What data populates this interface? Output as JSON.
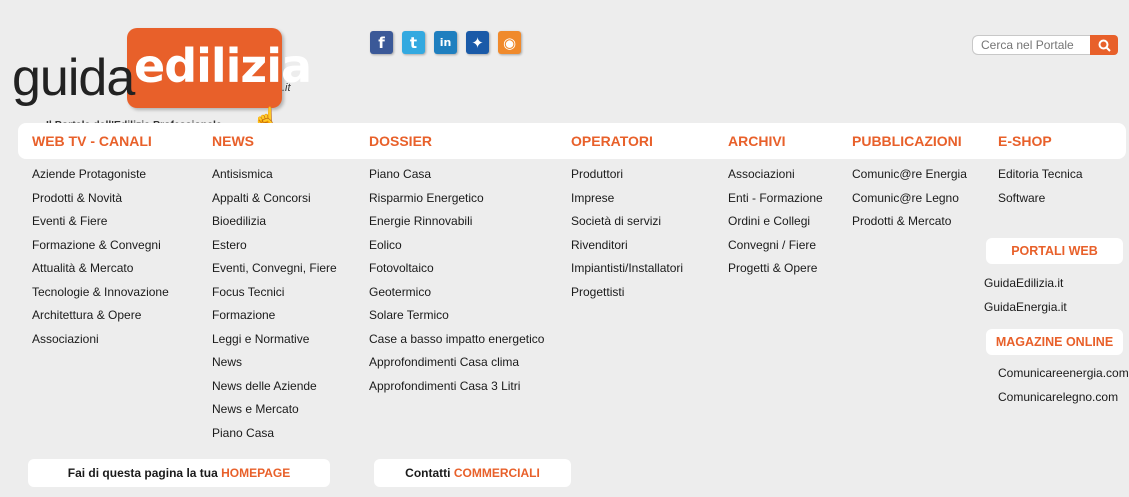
{
  "logo": {
    "guida": "guida",
    "edilizia": "edilizia",
    "it": ".it",
    "tagline": "Il Portale dell'Edilizia Professionale"
  },
  "social": [
    {
      "icon": "facebook-icon",
      "glyph": "f",
      "color": "#3b5998"
    },
    {
      "icon": "twitter-icon",
      "glyph": "t",
      "color": "#33a9e0"
    },
    {
      "icon": "linkedin-icon",
      "glyph": "in",
      "color": "#1f7fbf"
    },
    {
      "icon": "myspace-icon",
      "glyph": "✦",
      "color": "#1a5aa8"
    },
    {
      "icon": "rss-icon",
      "glyph": "◉",
      "color": "#f08a2c"
    }
  ],
  "search": {
    "placeholder": "Cerca nel Portale"
  },
  "columns": [
    {
      "head": "WEB TV - CANALI",
      "items": [
        "Aziende Protagoniste",
        "Prodotti & Novità",
        "Eventi & Fiere",
        "Formazione & Convegni",
        "Attualità & Mercato",
        "Tecnologie & Innovazione",
        "Architettura & Opere",
        "Associazioni"
      ]
    },
    {
      "head": "NEWS",
      "items": [
        "Antisismica",
        "Appalti & Concorsi",
        "Bioedilizia",
        "Estero",
        "Eventi, Convegni, Fiere",
        "Focus Tecnici",
        "Formazione",
        "Leggi e Normative",
        "News",
        "News delle Aziende",
        "News e Mercato",
        "Piano Casa"
      ]
    },
    {
      "head": "DOSSIER",
      "items": [
        "Piano Casa",
        "Risparmio Energetico",
        "Energie Rinnovabili",
        "Eolico",
        "Fotovoltaico",
        "Geotermico",
        "Solare Termico",
        "Case a basso impatto energetico",
        "Approfondimenti Casa clima",
        "Approfondimenti Casa 3 Litri"
      ]
    },
    {
      "head": "OPERATORI",
      "items": [
        "Produttori",
        "Imprese",
        "Società di servizi",
        "Rivenditori",
        "Impiantisti/Installatori",
        "Progettisti"
      ]
    },
    {
      "head": "ARCHIVI",
      "items": [
        "Associazioni",
        "Enti - Formazione",
        "Ordini e Collegi",
        "Convegni / Fiere",
        "Progetti & Opere"
      ]
    },
    {
      "head": "PUBBLICAZIONI",
      "items": [
        "Comunic@re Energia",
        "Comunic@re Legno",
        "Prodotti & Mercato"
      ]
    },
    {
      "head": "E-SHOP",
      "items": [
        "Editoria Tecnica",
        "Software"
      ]
    }
  ],
  "portali": {
    "title": "PORTALI WEB",
    "items": [
      "GuidaEdilizia.it",
      "GuidaEnergia.it"
    ]
  },
  "magazine": {
    "title": "MAGAZINE ONLINE",
    "items": [
      "Comunicareenergia.com",
      "Comunicarelegno.com"
    ]
  },
  "footer": {
    "homepage_text": "Fai di questa pagina la tua ",
    "homepage_accent": "HOMEPAGE",
    "contatti_text": "Contatti ",
    "contatti_accent": "COMMERCIALI"
  }
}
